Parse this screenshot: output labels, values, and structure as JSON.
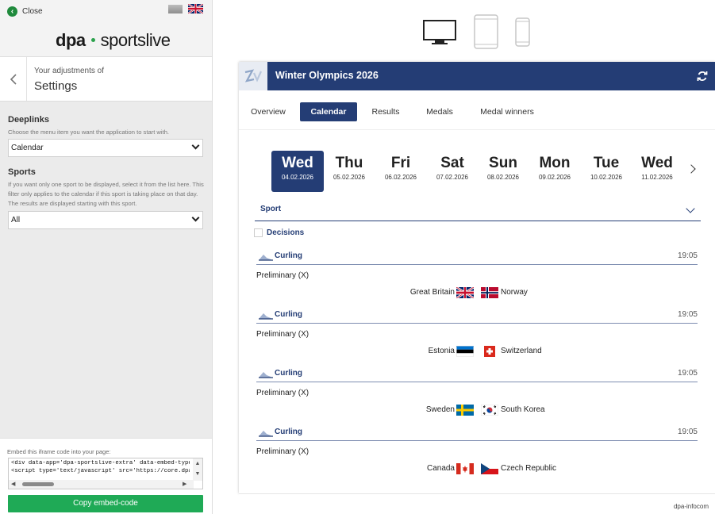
{
  "sidebar": {
    "close_label": "Close",
    "logo_primary": "dpa",
    "logo_secondary": "sportslive",
    "adjustments_label": "Your adjustments of",
    "settings_title": "Settings",
    "deeplinks": {
      "title": "Deeplinks",
      "description": "Choose the menu item you want the application to start with.",
      "selected": "Calendar"
    },
    "sports": {
      "title": "Sports",
      "description": "If you want only one sport to be displayed, select it from the list here. This filter only applies to the calendar if this sport is taking place on that day. The results are displayed starting with this sport.",
      "selected": "All"
    },
    "embed": {
      "label": "Embed this iframe code into your page:",
      "code_line1": "<div data-app='dpa-sportslive-extra' data-embed-type='ifra",
      "code_line2": "<script type='text/javascript' src='https://core.dpa-infocos",
      "copy_label": "Copy embed-code"
    }
  },
  "widget": {
    "title": "Winter Olympics 2026",
    "tabs": [
      {
        "label": "Overview",
        "active": false
      },
      {
        "label": "Calendar",
        "active": true
      },
      {
        "label": "Results",
        "active": false
      },
      {
        "label": "Medals",
        "active": false
      },
      {
        "label": "Medal winners",
        "active": false
      }
    ],
    "days": [
      {
        "name": "Wed",
        "date": "04.02.2026",
        "active": true
      },
      {
        "name": "Thu",
        "date": "05.02.2026",
        "active": false
      },
      {
        "name": "Fri",
        "date": "06.02.2026",
        "active": false
      },
      {
        "name": "Sat",
        "date": "07.02.2026",
        "active": false
      },
      {
        "name": "Sun",
        "date": "08.02.2026",
        "active": false
      },
      {
        "name": "Mon",
        "date": "09.02.2026",
        "active": false
      },
      {
        "name": "Tue",
        "date": "10.02.2026",
        "active": false
      },
      {
        "name": "Wed",
        "date": "11.02.2026",
        "active": false
      }
    ],
    "sport_filter_label": "Sport",
    "decisions_label": "Decisions",
    "events": [
      {
        "sport": "Curling",
        "time": "19:05",
        "round": "Preliminary (X)",
        "team1": "Great Britain",
        "team2": "Norway"
      },
      {
        "sport": "Curling",
        "time": "19:05",
        "round": "Preliminary (X)",
        "team1": "Estonia",
        "team2": "Switzerland"
      },
      {
        "sport": "Curling",
        "time": "19:05",
        "round": "Preliminary (X)",
        "team1": "Sweden",
        "team2": "South Korea"
      },
      {
        "sport": "Curling",
        "time": "19:05",
        "round": "Preliminary (X)",
        "team1": "Canada",
        "team2": "Czech Republic"
      }
    ],
    "footer": "dpa-infocom"
  },
  "colors": {
    "primary": "#243d75",
    "accent_green": "#1faa56",
    "sidebar_bg": "#ebebeb"
  }
}
